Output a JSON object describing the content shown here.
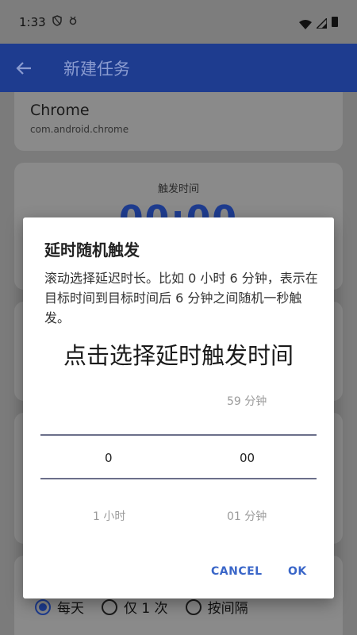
{
  "status_bar": {
    "time": "1:33"
  },
  "app_bar": {
    "title": "新建任务"
  },
  "app_card": {
    "name": "Chrome",
    "package": "com.android.chrome"
  },
  "time_card": {
    "label": "触发时间",
    "value": "00:00"
  },
  "repeat": {
    "options": [
      "每天",
      "仅 1 次",
      "按间隔"
    ],
    "selected_index": 0
  },
  "dialog": {
    "title": "延时随机触发",
    "message": "滚动选择延迟时长。比如 0 小时 6 分钟，表示在目标时间到目标时间后 6 分钟之间随机一秒触发。",
    "prompt": "点击选择延时触发时间",
    "hours": {
      "above": "",
      "selected": "0",
      "below": "1 小时"
    },
    "minutes": {
      "above": "59 分钟",
      "selected": "00",
      "below": "01 分钟"
    },
    "cancel_label": "CANCEL",
    "ok_label": "OK"
  },
  "colors": {
    "accent": "#1e3c8f",
    "dialog_button": "#3a66c8"
  },
  "icons": {
    "back": "arrow-left-icon"
  }
}
